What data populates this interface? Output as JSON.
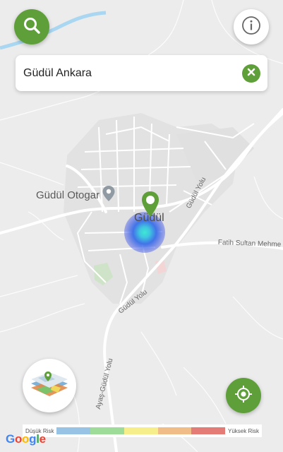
{
  "search": {
    "value": "Güdül Ankara"
  },
  "map": {
    "labels": {
      "bus_station": "Güdül Otogar",
      "town": "Güdül",
      "road_gudul_yolu_1": "Güdül Yolu",
      "road_gudul_yolu_2": "Güdül Yolu",
      "road_fatih_sultan": "Fatih Sultan Mehme",
      "road_ayas": "Ayaş-Güdül Yolu"
    }
  },
  "legend": {
    "low_label": "Düşük Risk",
    "high_label": "Yüksek Risk",
    "colors": [
      "#98c3e4",
      "#9edc9a",
      "#f5ee8a",
      "#f0bd88",
      "#e47b77"
    ]
  },
  "attribution": {
    "google": "Google"
  },
  "icons": {
    "search": "search-icon",
    "info": "info-icon",
    "clear": "close-icon",
    "layers": "map-layers-icon",
    "locate": "my-location-icon",
    "pin": "map-pin-icon",
    "bus_station": "location-pin-icon"
  },
  "colors": {
    "accent": "#5f9f3a",
    "heat": "#3a4fe0",
    "water": "#a9d6f0"
  }
}
